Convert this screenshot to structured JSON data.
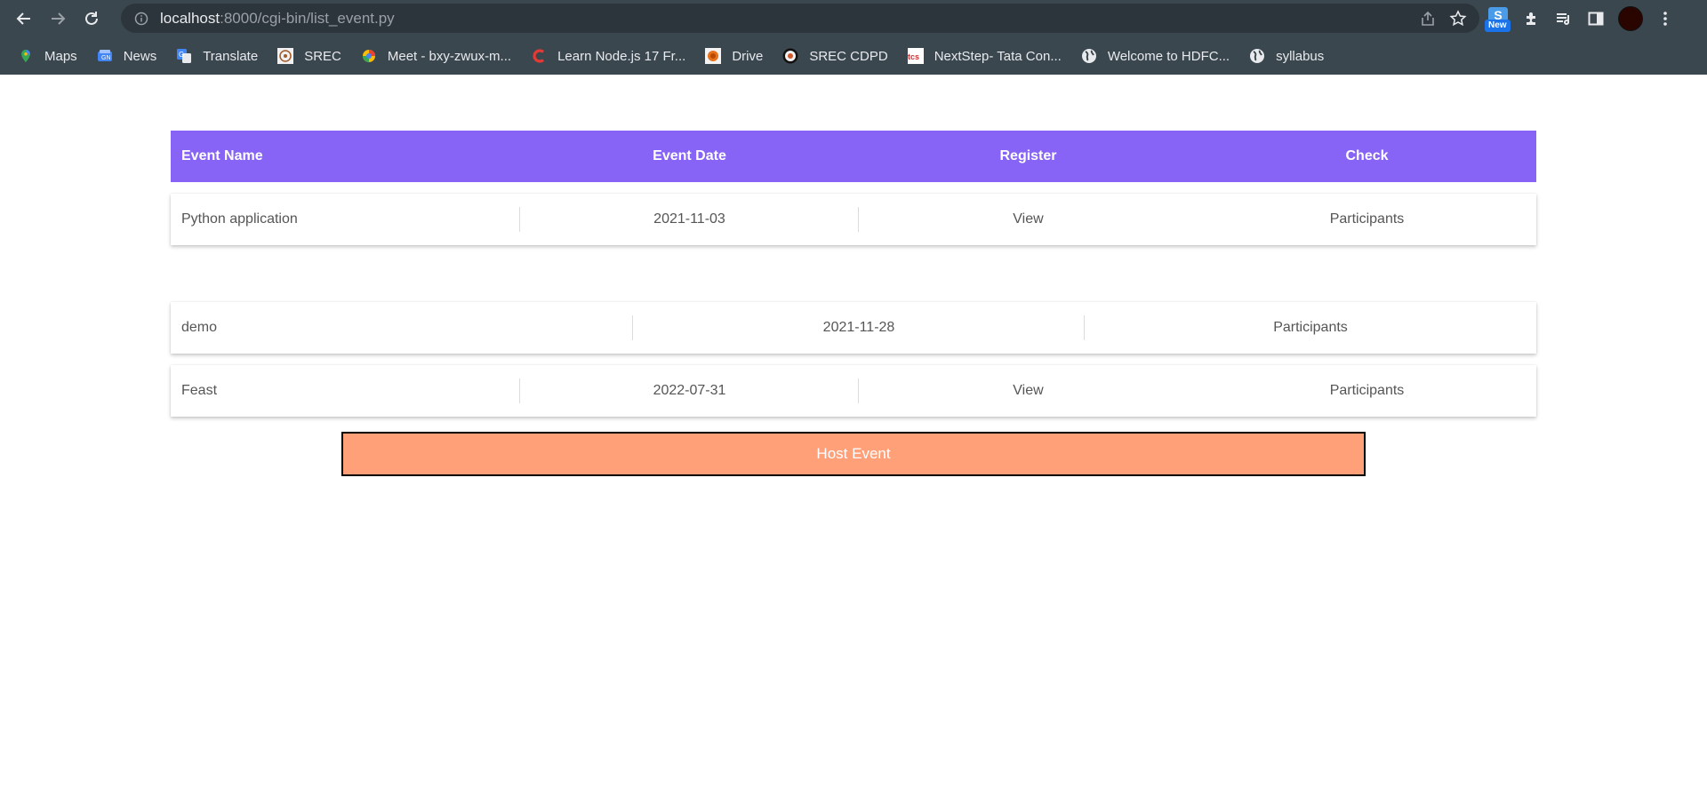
{
  "browser": {
    "url_host": "localhost",
    "url_rest": ":8000/cgi-bin/list_event.py",
    "extension_badge": "New",
    "extension_letter": "S",
    "bookmarks": [
      {
        "label": "Maps",
        "icon": "maps-icon"
      },
      {
        "label": "News",
        "icon": "news-icon"
      },
      {
        "label": "Translate",
        "icon": "translate-icon"
      },
      {
        "label": "SREC",
        "icon": "srec-icon"
      },
      {
        "label": "Meet - bxy-zwux-m...",
        "icon": "meet-icon"
      },
      {
        "label": "Learn Node.js 17 Fr...",
        "icon": "learn-icon"
      },
      {
        "label": "Drive",
        "icon": "drive-icon"
      },
      {
        "label": "SREC CDPD",
        "icon": "srec-cdpd-icon"
      },
      {
        "label": "NextStep- Tata Con...",
        "icon": "tcs-icon"
      },
      {
        "label": "Welcome to HDFC...",
        "icon": "globe-icon"
      },
      {
        "label": "syllabus",
        "icon": "globe-icon"
      }
    ]
  },
  "table": {
    "headers": [
      "Event Name",
      "Event Date",
      "Register",
      "Check"
    ],
    "rows": [
      {
        "name": "Python application",
        "date": "2021-11-03",
        "register": "View",
        "check": "Participants"
      },
      {
        "name": "demo",
        "date": "2021-11-28",
        "check": "Participants"
      },
      {
        "name": "Feast",
        "date": "2022-07-31",
        "register": "View",
        "check": "Participants"
      }
    ]
  },
  "host_button_label": "Host Event",
  "colors": {
    "header_bg": "#8764f5",
    "host_button_bg": "#ffa078",
    "chrome_bg": "#3b474f"
  }
}
